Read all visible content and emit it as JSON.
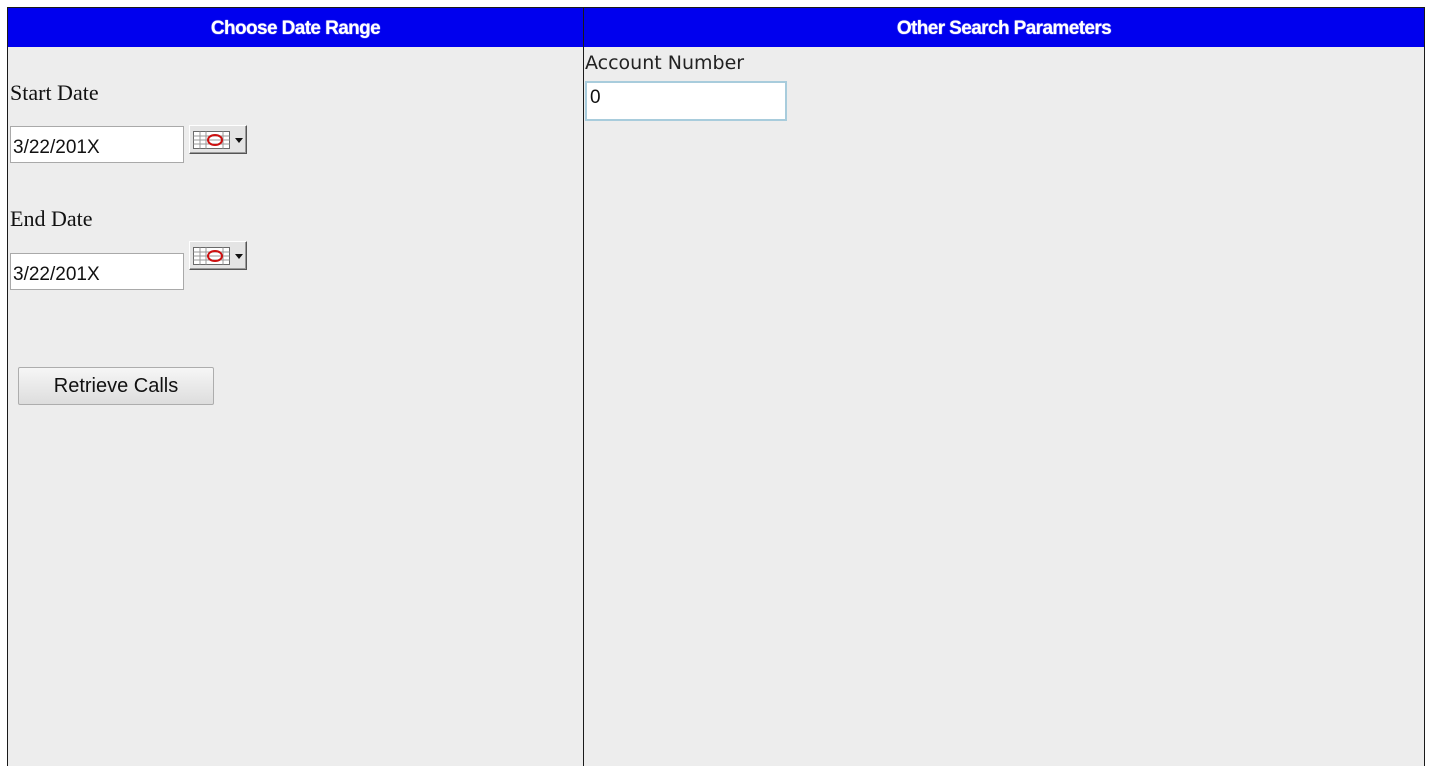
{
  "left_panel": {
    "header": "Choose Date Range",
    "start_date": {
      "label": "Start Date",
      "value": "3/22/201X",
      "picker_icon": "calendar-dropdown-icon"
    },
    "end_date": {
      "label": "End Date",
      "value": "3/22/201X",
      "picker_icon": "calendar-dropdown-icon"
    },
    "retrieve_button": "Retrieve Calls"
  },
  "right_panel": {
    "header": "Other Search Parameters",
    "account_number": {
      "label": "Account Number",
      "value": "0"
    }
  },
  "colors": {
    "header_bg": "#0000ee",
    "header_text": "#ffffff",
    "panel_bg": "#ededed",
    "input_focus_border": "#a8ccdc"
  }
}
